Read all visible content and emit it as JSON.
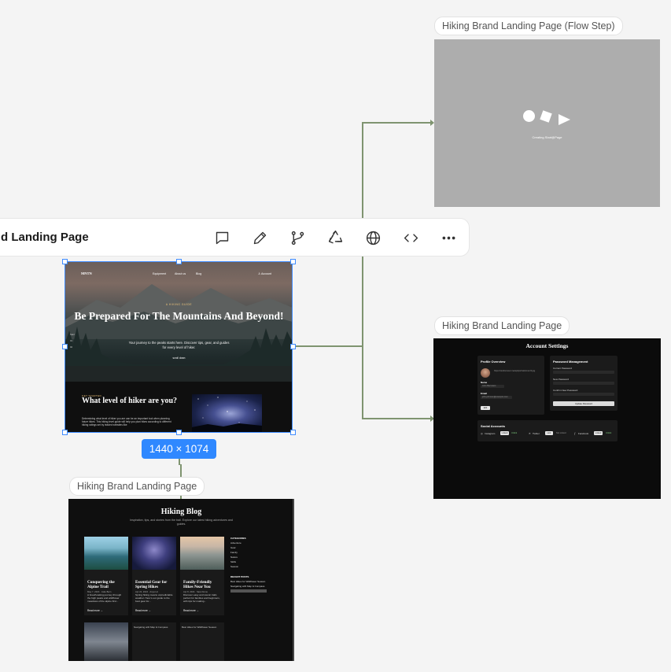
{
  "canvas": {
    "flow_label": "Hiking Brand Landing Page (Flow Step)",
    "account_label": "Hiking Brand Landing Page",
    "blog_label": "Hiking Brand Landing Page",
    "size_badge": "1440 × 1074"
  },
  "toolbar": {
    "title": "d Landing Page",
    "icons": [
      "comment-icon",
      "pencil-icon",
      "branch-icon",
      "recycle-icon",
      "globe-icon",
      "code-icon",
      "more-icon"
    ]
  },
  "flow_frame": {
    "bg": "#adadad",
    "loading_text": "Creating Start@Page"
  },
  "landing": {
    "brand": "MNTN",
    "nav": [
      "Equipment",
      "About us",
      "Blog"
    ],
    "account": "Account",
    "eyebrow": "A HIKING GUIDE",
    "hero_title": "Be Prepared For The Mountains And Beyond!",
    "hero_sub": "Your journey to the peaks starts here. Discover tips, gear, and guides for every level of hiker.",
    "scroll": "scroll down",
    "side_nav": [
      "Start",
      "01",
      "02"
    ],
    "section_eyebrow": "GET STARTED",
    "section_title": "What level of hiker are you?",
    "section_text": "Determining what level of hiker you are can be an important tool when planning future hikes. This hiking level guide will help you plan hikes according to different hiking ratings set by leaded websites like"
  },
  "account": {
    "title": "Account Settings",
    "profile": {
      "heading": "Profile Overview",
      "avatar_url": "https://randomuser.me/api/portraits/men/3.jpg",
      "name_label": "Name",
      "name": "John Bernstein",
      "email_label": "Email",
      "email": "john.johnson@example.com",
      "edit": "Edit"
    },
    "password": {
      "heading": "Password Management",
      "current": "Current Password",
      "new": "New Password",
      "confirm": "Confirm New Password",
      "button": "Update Password"
    },
    "social": {
      "heading": "Social Accounts",
      "items": [
        {
          "name": "Instagram",
          "status": "Linked",
          "action": "Unlink"
        },
        {
          "name": "Twitter",
          "status": "Link",
          "action": "Not Linked"
        },
        {
          "name": "Facebook",
          "status": "Linked",
          "action": "Unlink"
        }
      ]
    }
  },
  "blog": {
    "title": "Hiking Blog",
    "subtitle": "Inspiration, tips, and stories from the trail. Explore our latest hiking adventures and guides.",
    "posts": [
      {
        "title": "Conquering the Alpine Trail",
        "meta": "May 7, 2024 · Jake Bern",
        "excerpt": "A breath-taking journey through the high peaks and wildflower meadows of the alpine first...",
        "read": "Read more →"
      },
      {
        "title": "Essential Gear for Spring Hikes",
        "meta": "Apr 22, 2024 · Anya Lin",
        "excerpt": "Spring hiking means unpredictable weather. Here's our guide to the best gear for...",
        "read": "Read more →"
      },
      {
        "title": "Family-Friendly Hikes Near You",
        "meta": "Apr 8, 2024 · Sara Dome",
        "excerpt": "Discover easy and scenic trails perfect for families and beginners, with tips for making...",
        "read": "Read more →"
      }
    ],
    "row2": [
      "",
      "Navigating with Map & Compass",
      "Best Hikes for Wildflower Season"
    ],
    "categories_heading": "CATEGORIES",
    "categories": [
      "Adventure",
      "Gear",
      "Family",
      "Nature",
      "Skills",
      "Season"
    ],
    "recent_heading": "RECENT POSTS",
    "recent": [
      "Best Hikes for Wildflower Season",
      "Navigating with Map & Compass"
    ]
  }
}
